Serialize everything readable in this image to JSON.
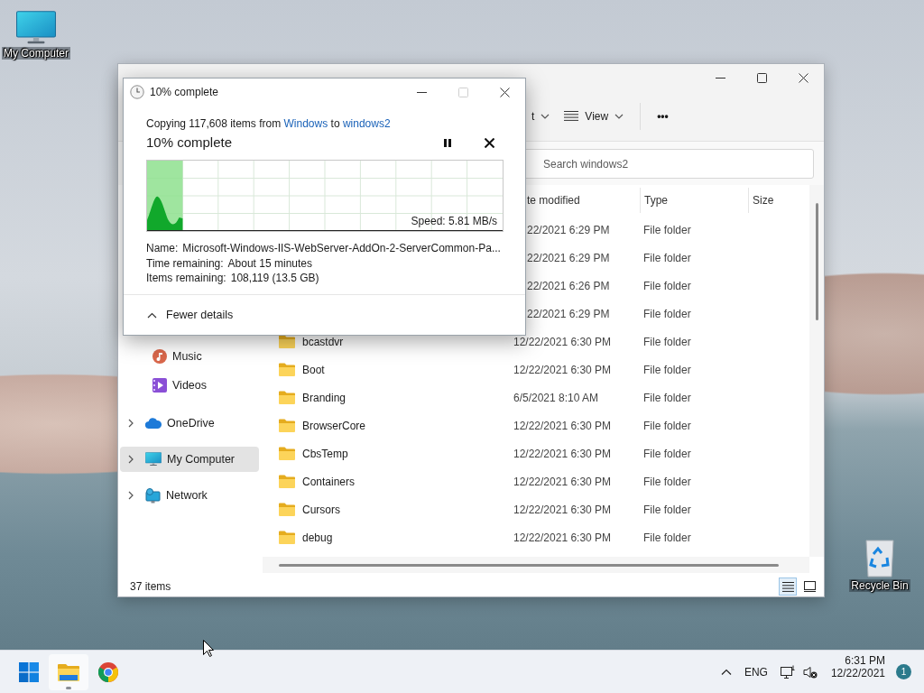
{
  "desktop_icons": [
    {
      "kind": "computer",
      "label": "My Computer"
    },
    {
      "kind": "recycle_bin",
      "label": "Recycle Bin"
    }
  ],
  "explorer": {
    "toolbar": [
      {
        "kind": "dropdown",
        "label": "t"
      },
      {
        "kind": "view",
        "label": "View"
      },
      {
        "kind": "more",
        "label": "•••"
      }
    ],
    "search": {
      "placeholder": "Search windows2"
    },
    "sidebar": {
      "pinned": [
        {
          "kind": "music",
          "label": "Music",
          "selected": false
        },
        {
          "kind": "videos",
          "label": "Videos",
          "selected": false
        }
      ],
      "roots": [
        {
          "kind": "cloud",
          "label": "OneDrive",
          "selected": false,
          "expanded": false
        },
        {
          "kind": "computer",
          "label": "My Computer",
          "selected": true,
          "expanded": false
        },
        {
          "kind": "network",
          "label": "Network",
          "selected": false,
          "expanded": false
        }
      ]
    },
    "columns": [
      "te modified",
      "Type",
      "Size"
    ],
    "rows": [
      {
        "date": "22/2021 6:29 PM",
        "type": "File folder"
      },
      {
        "date": "22/2021 6:29 PM",
        "type": "File folder"
      },
      {
        "date": "22/2021 6:26 PM",
        "type": "File folder"
      },
      {
        "date": "22/2021 6:29 PM",
        "type": "File folder"
      },
      {
        "name": "bcastdvr",
        "date": "12/22/2021 6:30 PM",
        "type": "File folder"
      },
      {
        "name": "Boot",
        "date": "12/22/2021 6:30 PM",
        "type": "File folder"
      },
      {
        "name": "Branding",
        "date": "6/5/2021 8:10 AM",
        "type": "File folder"
      },
      {
        "name": "BrowserCore",
        "date": "12/22/2021 6:30 PM",
        "type": "File folder"
      },
      {
        "name": "CbsTemp",
        "date": "12/22/2021 6:30 PM",
        "type": "File folder"
      },
      {
        "name": "Containers",
        "date": "12/22/2021 6:30 PM",
        "type": "File folder"
      },
      {
        "name": "Cursors",
        "date": "12/22/2021 6:30 PM",
        "type": "File folder"
      },
      {
        "name": "debug",
        "date": "12/22/2021 6:30 PM",
        "type": "File folder"
      }
    ],
    "status": "37 items",
    "view_modes": [
      {
        "kind": "details",
        "selected": true
      },
      {
        "kind": "tiles",
        "selected": false
      }
    ]
  },
  "copy_dialog": {
    "title": "10% complete",
    "maximize_enabled": false,
    "copy_text": {
      "before": "Copying 117,608 items from",
      "source": "Windows",
      "between": "to",
      "destination": "windows2"
    },
    "heading": "10% complete",
    "level": 0.1,
    "speed": "Speed: 5.81 MB/s",
    "details": [
      {
        "label": "Name:",
        "value": "Microsoft-Windows-IIS-WebServer-AddOn-2-ServerCommon-Pa..."
      },
      {
        "label": "Time remaining:",
        "value": "About 15 minutes"
      },
      {
        "label": "Items remaining:",
        "value": "108,119 (13.5 GB)"
      }
    ],
    "details_toggle": {
      "label": "Fewer details",
      "expanded": true
    }
  },
  "taskbar": {
    "apps": [
      {
        "kind": "start",
        "running": false
      },
      {
        "kind": "explorer",
        "running": true
      },
      {
        "kind": "browser",
        "running": false
      }
    ],
    "language": "ENG",
    "time": "6:31 PM",
    "date": "12/22/2021",
    "notification_count": "1"
  }
}
